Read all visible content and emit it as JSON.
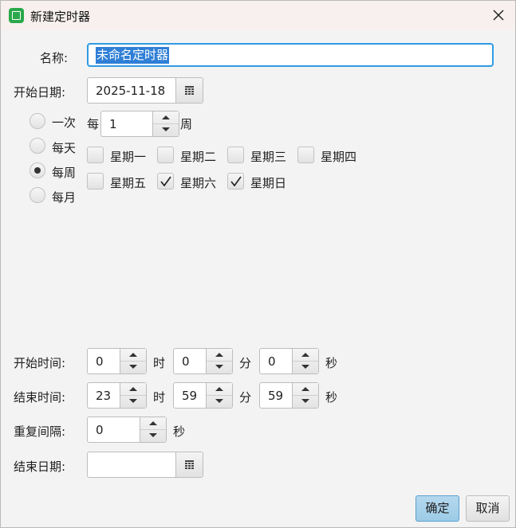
{
  "window": {
    "title": "新建定时器",
    "icon": "timer-chip-icon",
    "accent_color": "#2f9be3",
    "app_icon_color": "#2aa84a"
  },
  "form": {
    "name_label": "名称:",
    "name_value": "未命名定时器",
    "start_date_label": "开始日期:",
    "start_date_value": "2025-11-18",
    "start_time_label": "开始时间:",
    "end_time_label": "结束时间:",
    "repeat_label": "重复间隔:",
    "end_date_label": "结束日期:",
    "end_date_value": ""
  },
  "frequency": {
    "options": [
      {
        "label": "一次",
        "selected": false
      },
      {
        "label": "每天",
        "selected": false
      },
      {
        "label": "每周",
        "selected": true
      },
      {
        "label": "每月",
        "selected": false
      }
    ]
  },
  "weekly": {
    "every_prefix": "每",
    "every_value": "1",
    "every_suffix": "周",
    "days": [
      {
        "label": "星期一",
        "checked": false
      },
      {
        "label": "星期二",
        "checked": false
      },
      {
        "label": "星期三",
        "checked": false
      },
      {
        "label": "星期四",
        "checked": false
      },
      {
        "label": "星期五",
        "checked": false
      },
      {
        "label": "星期六",
        "checked": true
      },
      {
        "label": "星期日",
        "checked": true
      }
    ]
  },
  "start_time": {
    "hour": "0",
    "minute": "0",
    "second": "0"
  },
  "end_time": {
    "hour": "23",
    "minute": "59",
    "second": "59"
  },
  "units": {
    "hour": "时",
    "minute": "分",
    "second": "秒"
  },
  "repeat": {
    "value": "0",
    "unit": "秒"
  },
  "buttons": {
    "ok": "确定",
    "cancel": "取消"
  }
}
